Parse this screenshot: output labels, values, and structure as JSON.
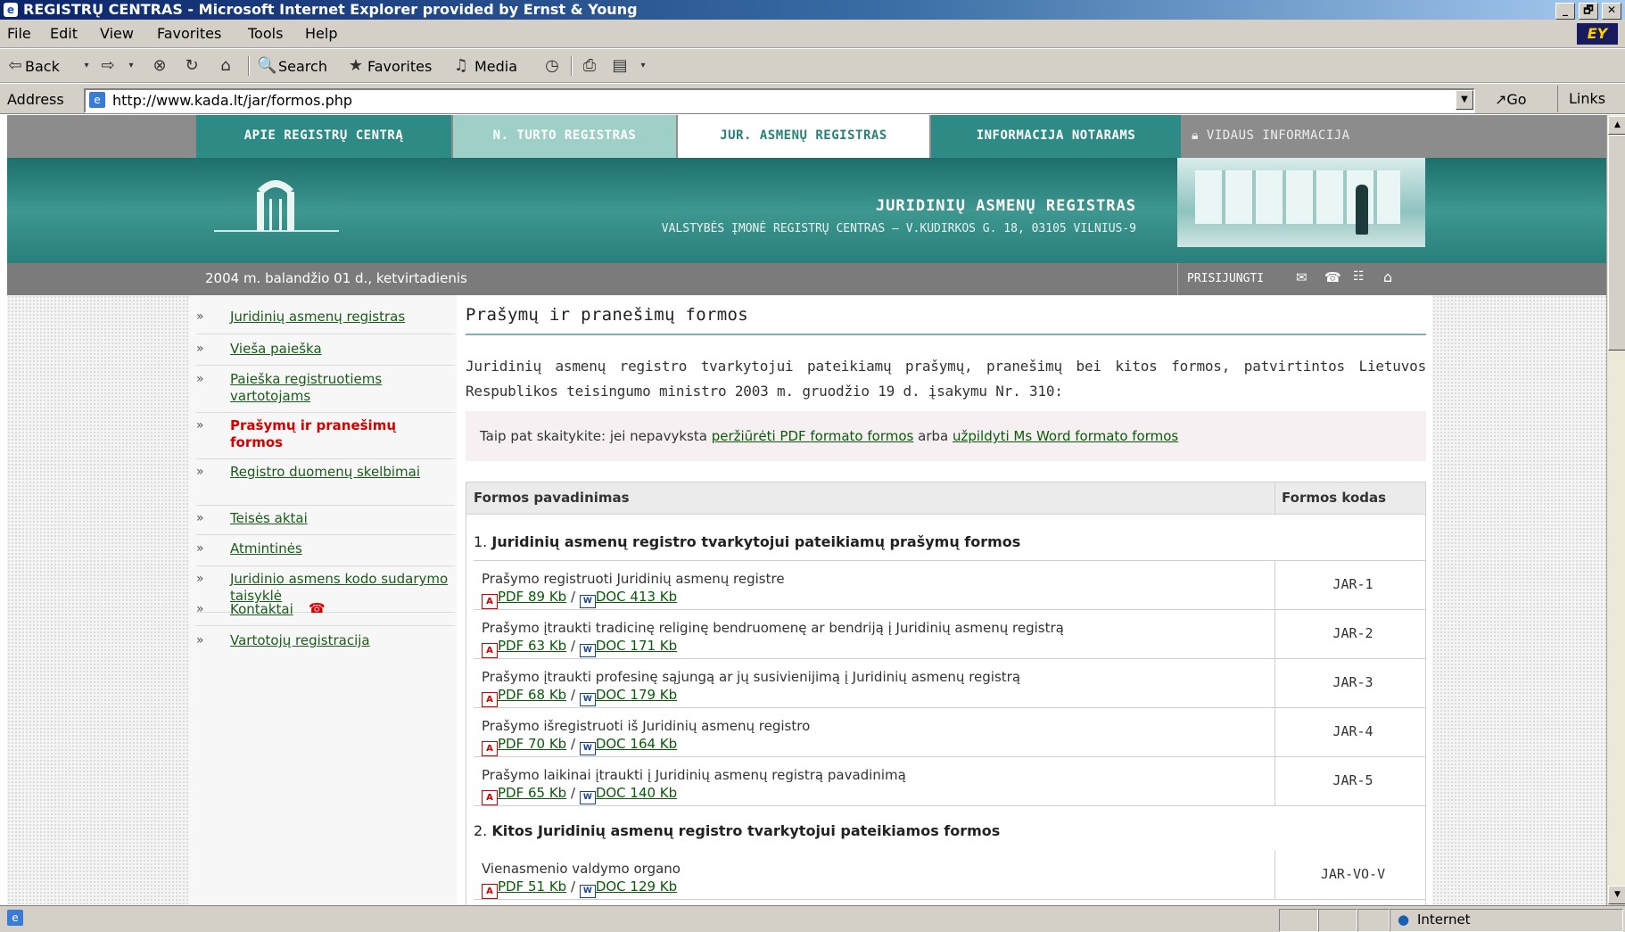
{
  "window": {
    "title": "REGISTRŲ CENTRAS - Microsoft Internet Explorer provided by Ernst & Young",
    "min": "_",
    "max": "🗗",
    "close": "✕"
  },
  "menubar": {
    "items": [
      "File",
      "Edit",
      "View",
      "Favorites",
      "Tools",
      "Help"
    ]
  },
  "toolbar": {
    "back": "Back",
    "search": "Search",
    "favorites": "Favorites",
    "media": "Media"
  },
  "address": {
    "label": "Address",
    "url": "http://www.kada.lt/jar/formos.php",
    "go": "Go",
    "links": "Links"
  },
  "nav": {
    "tabs": [
      "APIE REGISTRŲ CENTRĄ",
      "N. TURTO REGISTRAS",
      "JUR. ASMENŲ REGISTRAS",
      "INFORMACIJA NOTARAMS",
      "VIDAUS INFORMACIJA"
    ],
    "active_index": 2
  },
  "banner": {
    "title": "JURIDINIŲ ASMENŲ REGISTRAS",
    "subtitle": "VALSTYBĖS ĮMONĖ REGISTRŲ CENTRAS – V.KUDIRKOS G. 18, 03105 VILNIUS-9"
  },
  "datebar": {
    "date": "2004 m. balandžio 01 d., ketvirtadienis",
    "login": "PRISIJUNGTI"
  },
  "sidebar": {
    "items": [
      {
        "label": "Juridinių asmenų registras"
      },
      {
        "label": "Vieša paieška"
      },
      {
        "label": "Paieška registruotiems vartotojams"
      },
      {
        "label": "Prašymų ir pranešimų formos",
        "active": true
      },
      {
        "label": "Registro duomenų skelbimai"
      },
      {
        "label": "Teisės aktai"
      },
      {
        "label": "Atmintinės"
      },
      {
        "label": "Juridinio asmens kodo sudarymo taisyklė"
      },
      {
        "label": "Kontaktai"
      },
      {
        "label": "Vartotojų registracija"
      }
    ]
  },
  "main": {
    "heading": "Prašymų ir pranešimų formos",
    "intro": "Juridinių asmenų registro tvarkytojui pateikiamų prašymų, pranešimų bei kitos formos, patvirtintos Lietuvos Respublikos teisingumo ministro 2003 m. gruodžio 19 d. įsakymu Nr. 310:",
    "note": {
      "prefix": "Taip pat skaitykite: jei nepavyksta ",
      "link1": "peržiūrėti PDF formato formos",
      "middle": " arba ",
      "link2": "užpildyti Ms Word formato formos"
    },
    "table": {
      "col_name": "Formos pavadinimas",
      "col_code": "Formos kodas",
      "section1": {
        "num": "1. ",
        "title": "Juridinių asmenų registro tvarkytojui pateikiamų prašymų formos"
      },
      "section2": {
        "num": "2. ",
        "title": "Kitos Juridinių asmenų registro tvarkytojui pateikiamos formos"
      },
      "rows": [
        {
          "name": "Prašymo registruoti Juridinių asmenų registre",
          "pdf": "PDF 89 Kb",
          "doc": "DOC 413 Kb",
          "code": "JAR-1"
        },
        {
          "name": "Prašymo įtraukti tradicinę religinę bendruomenę ar bendriją į Juridinių asmenų registrą",
          "pdf": "PDF 63 Kb",
          "doc": "DOC 171 Kb",
          "code": "JAR-2"
        },
        {
          "name": "Prašymo įtraukti profesinę sąjungą ar jų susivienijimą į Juridinių asmenų registrą",
          "pdf": "PDF 68 Kb",
          "doc": "DOC 179 Kb",
          "code": "JAR-3"
        },
        {
          "name": "Prašymo išregistruoti iš Juridinių asmenų registro",
          "pdf": "PDF 70 Kb",
          "doc": "DOC 164 Kb",
          "code": "JAR-4"
        },
        {
          "name": "Prašymo laikinai įtraukti į Juridinių asmenų registrą pavadinimą",
          "pdf": "PDF 65 Kb",
          "doc": "DOC 140 Kb",
          "code": "JAR-5"
        },
        {
          "name": "Vienasmenio valdymo organo",
          "pdf": "PDF 51 Kb",
          "doc": "DOC 129 Kb",
          "code": "JAR-VO-V"
        }
      ],
      "link_sep": " / "
    }
  },
  "statusbar": {
    "zone": "Internet"
  },
  "colors": {
    "teal": "#2a7f7a",
    "active_red": "#d40000",
    "link_green": "#0a5a0a"
  }
}
